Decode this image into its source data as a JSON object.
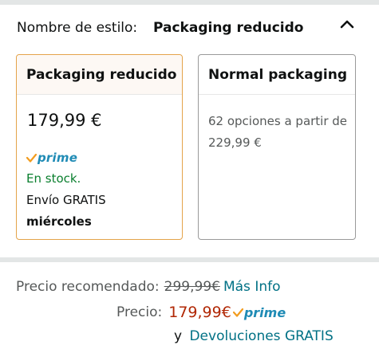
{
  "style_selector": {
    "label": "Nombre de estilo:",
    "selected": "Packaging reducido",
    "collapse_icon": "chevron-up-icon"
  },
  "options": [
    {
      "title": "Packaging reducido",
      "price": "179,99 €",
      "prime": "prime",
      "stock": "En stock.",
      "shipping": "Envío GRATIS",
      "delivery_day": "miércoles"
    },
    {
      "title": "Normal packaging",
      "offers_text": "62 opciones a partir de 229,99 €"
    }
  ],
  "pricing": {
    "recommended_label": "Precio recomendado:",
    "recommended_price": "299,99€",
    "more_info": "Más Info",
    "price_label": "Precio:",
    "price": "179,99€",
    "prime": "prime",
    "returns_prefix": "y",
    "returns_link": "Devoluciones GRATIS"
  },
  "colors": {
    "selected_border": "#e4a34a",
    "stock_green": "#0a7f2e",
    "deal_red": "#b12704",
    "link_teal": "#007185",
    "prime_blue": "#1f8bb5",
    "prime_check": "#f29c1f"
  }
}
